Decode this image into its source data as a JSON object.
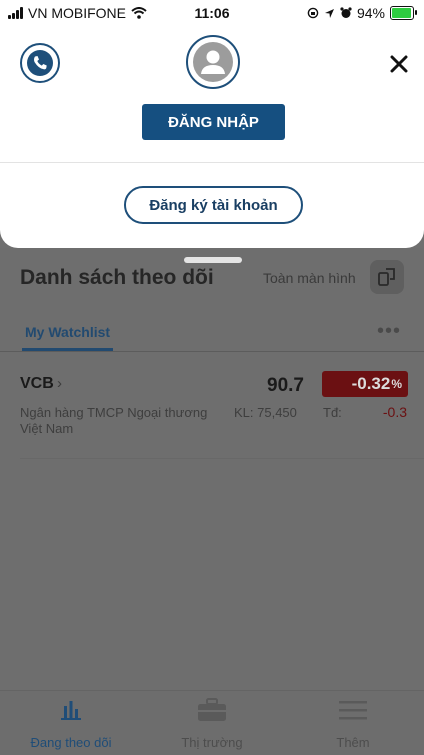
{
  "status_bar": {
    "carrier": "VN MOBIFONE",
    "time": "11:06",
    "battery": "94%",
    "battery_level": 0.94
  },
  "sheet": {
    "login_label": "ĐĂNG NHẬP",
    "register_label": "Đăng ký tài khoản",
    "icons": [
      "phone-icon",
      "user-avatar-icon",
      "close-icon"
    ]
  },
  "watchlist": {
    "title": "Danh sách theo dõi",
    "fullscreen_label": "Toàn màn hình",
    "tab_label": "My Watchlist",
    "more": "•••",
    "rows": [
      {
        "symbol": "VCB",
        "name": "Ngân hàng TMCP Ngoại thương Việt Nam",
        "price": "90.7",
        "change_pct": "-0.32",
        "pct_sign": "%",
        "volume": "KL: 75,450",
        "td_label": "Tđ:",
        "td_value": "-0.3"
      }
    ]
  },
  "tabbar": {
    "items": [
      {
        "label": "Đang theo dõi",
        "icon": "bar-chart-icon",
        "active": true
      },
      {
        "label": "Thị trường",
        "icon": "briefcase-icon",
        "active": false
      },
      {
        "label": "Thêm",
        "icon": "menu-icon",
        "active": false
      }
    ]
  },
  "colors": {
    "primary": "#154f80",
    "negative_bg": "#6b1012",
    "sheet_bg": "#ffffff",
    "dim_bg": "#6e6e6e"
  }
}
